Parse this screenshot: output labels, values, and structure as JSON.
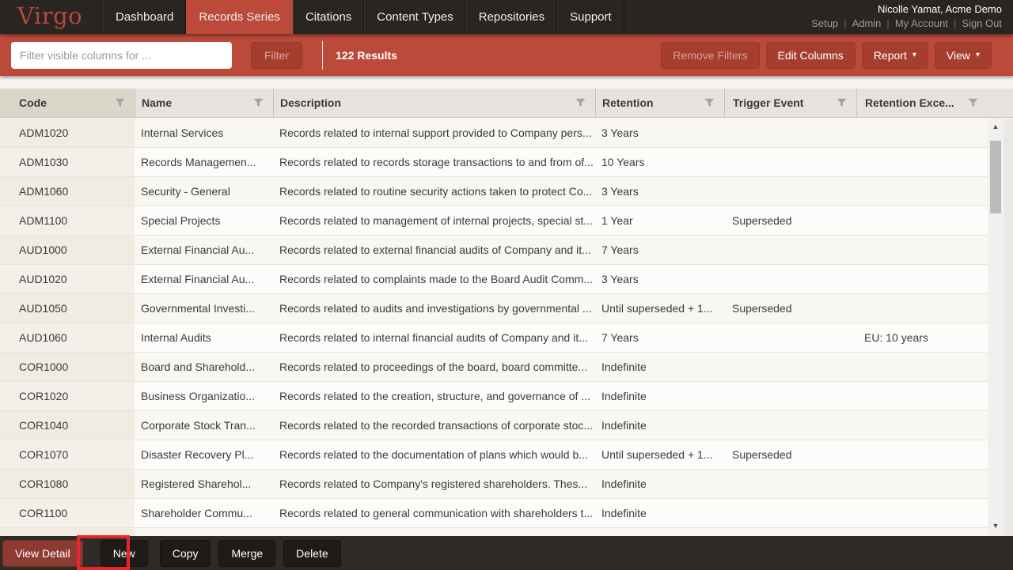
{
  "app": {
    "logo": "Virgo"
  },
  "nav": {
    "tabs": [
      {
        "label": "Dashboard",
        "active": false
      },
      {
        "label": "Records Series",
        "active": true
      },
      {
        "label": "Citations",
        "active": false
      },
      {
        "label": "Content Types",
        "active": false
      },
      {
        "label": "Repositories",
        "active": false
      },
      {
        "label": "Support",
        "active": false
      }
    ],
    "user": {
      "name": "Nicolle Yamat, Acme Demo",
      "links": [
        "Setup",
        "Admin",
        "My Account",
        "Sign Out"
      ]
    }
  },
  "toolbar": {
    "filter_placeholder": "Filter visible columns for ...",
    "filter_button": "Filter",
    "results": "122 Results",
    "remove_filters": "Remove Filters",
    "edit_columns": "Edit Columns",
    "report": "Report",
    "view": "View"
  },
  "table": {
    "columns": [
      {
        "label": "Code"
      },
      {
        "label": "Name"
      },
      {
        "label": "Description"
      },
      {
        "label": "Retention"
      },
      {
        "label": "Trigger Event"
      },
      {
        "label": "Retention Exce..."
      }
    ],
    "rows": [
      {
        "code": "ADM1020",
        "name": "Internal Services",
        "description": "Records related to internal support provided to Company pers...",
        "retention": "3 Years",
        "trigger_event": "",
        "retention_exceptions": ""
      },
      {
        "code": "ADM1030",
        "name": "Records Managemen...",
        "description": "Records related to records storage transactions to and from of...",
        "retention": "10 Years",
        "trigger_event": "",
        "retention_exceptions": ""
      },
      {
        "code": "ADM1060",
        "name": "Security - General",
        "description": "Records related to routine security actions taken to protect Co...",
        "retention": "3 Years",
        "trigger_event": "",
        "retention_exceptions": ""
      },
      {
        "code": "ADM1100",
        "name": "Special Projects",
        "description": "Records related to management of internal projects, special st...",
        "retention": "1 Year",
        "trigger_event": "Superseded",
        "retention_exceptions": ""
      },
      {
        "code": "AUD1000",
        "name": "External Financial Au...",
        "description": "Records related to external financial audits of Company and it...",
        "retention": "7 Years",
        "trigger_event": "",
        "retention_exceptions": ""
      },
      {
        "code": "AUD1020",
        "name": "External Financial Au...",
        "description": "Records related to complaints made to the Board Audit Comm...",
        "retention": "3 Years",
        "trigger_event": "",
        "retention_exceptions": ""
      },
      {
        "code": "AUD1050",
        "name": "Governmental Investi...",
        "description": "Records related to audits and investigations by governmental ...",
        "retention": "Until superseded + 1...",
        "trigger_event": "Superseded",
        "retention_exceptions": ""
      },
      {
        "code": "AUD1060",
        "name": "Internal Audits",
        "description": "Records related to internal financial audits of Company and it...",
        "retention": "7 Years",
        "trigger_event": "",
        "retention_exceptions": "EU: 10 years"
      },
      {
        "code": "COR1000",
        "name": "Board and Sharehold...",
        "description": "Records related to proceedings of the board, board committe...",
        "retention": "Indefinite",
        "trigger_event": "",
        "retention_exceptions": ""
      },
      {
        "code": "COR1020",
        "name": "Business Organizatio...",
        "description": "Records related to the creation, structure, and governance of ...",
        "retention": "Indefinite",
        "trigger_event": "",
        "retention_exceptions": ""
      },
      {
        "code": "COR1040",
        "name": "Corporate Stock Tran...",
        "description": "Records related to the recorded transactions of corporate stoc...",
        "retention": "Indefinite",
        "trigger_event": "",
        "retention_exceptions": ""
      },
      {
        "code": "COR1070",
        "name": "Disaster Recovery Pl...",
        "description": "Records related to the documentation of plans which would b...",
        "retention": "Until superseded + 1...",
        "trigger_event": "Superseded",
        "retention_exceptions": ""
      },
      {
        "code": "COR1080",
        "name": "Registered Sharehol...",
        "description": "Records related to Company's registered shareholders. Thes...",
        "retention": "Indefinite",
        "trigger_event": "",
        "retention_exceptions": ""
      },
      {
        "code": "COR1100",
        "name": "Shareholder Commu...",
        "description": "Records related to general communication with shareholders t...",
        "retention": "Indefinite",
        "trigger_event": "",
        "retention_exceptions": ""
      }
    ]
  },
  "footer": {
    "buttons": [
      "View Detail",
      "New",
      "Copy",
      "Merge",
      "Delete"
    ],
    "gear_icon": "settings"
  },
  "annotation": {
    "highlighted_button": "New",
    "color": "#e8262d"
  },
  "colors": {
    "brand_red": "#b6493a",
    "toolbar_red": "#bc4a3b",
    "button_red": "#a63e30",
    "nav_bg": "#292522",
    "footer_bg": "#2e2a26",
    "highlight_red": "#e8262d"
  }
}
